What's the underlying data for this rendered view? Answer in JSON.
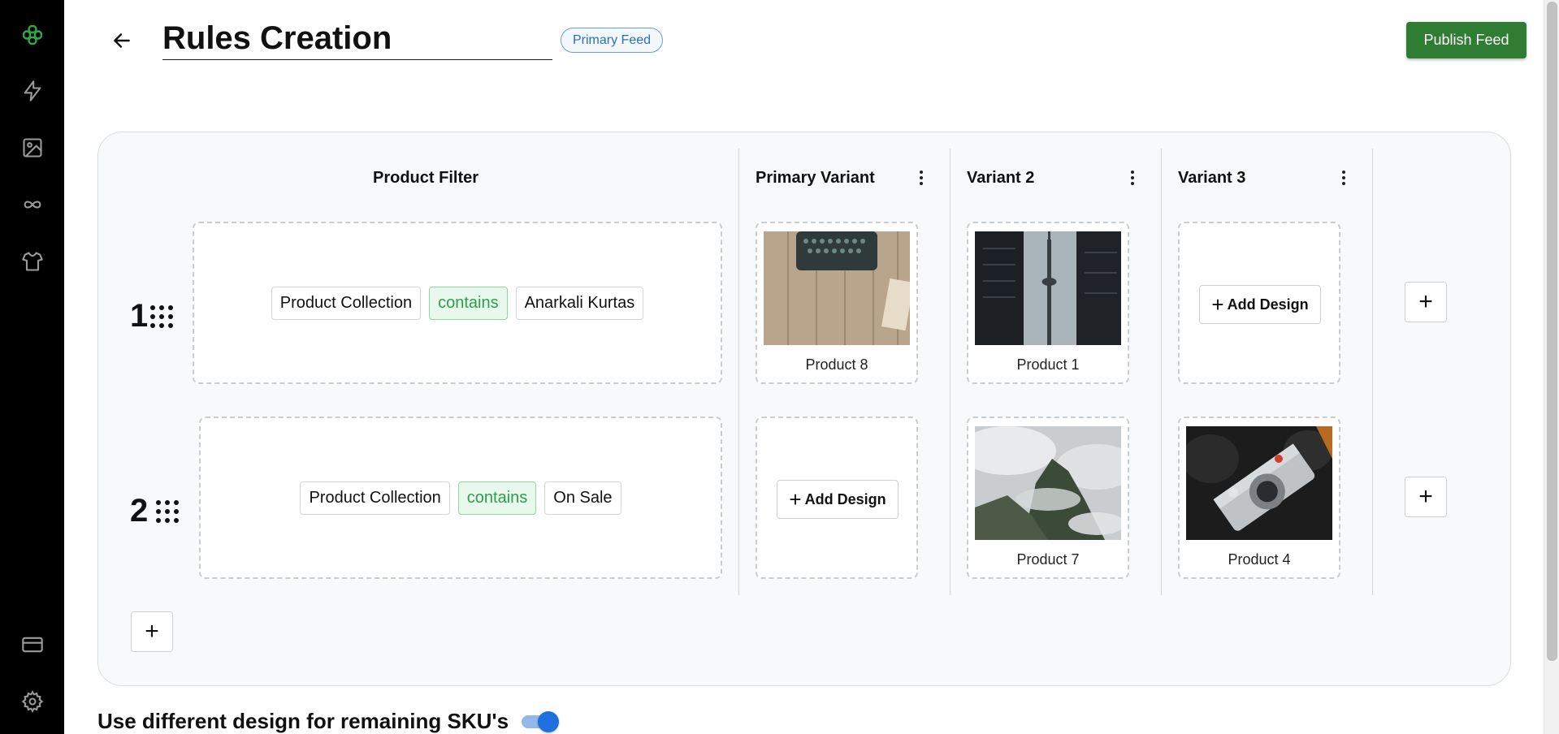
{
  "sidebar": {
    "items": [
      {
        "icon": "logo-icon"
      },
      {
        "icon": "lightning-icon"
      },
      {
        "icon": "image-icon"
      },
      {
        "icon": "infinity-icon"
      },
      {
        "icon": "shirt-icon"
      },
      {
        "icon": "credit-card-icon"
      },
      {
        "icon": "gear-icon"
      }
    ],
    "accent_color": "#2ea84f"
  },
  "header": {
    "title": "Rules Creation",
    "badge": "Primary Feed",
    "publish_label": "Publish Feed",
    "publish_color": "#2e7d32"
  },
  "columns": {
    "filter": "Product Filter",
    "variants": [
      "Primary Variant",
      "Variant 2",
      "Variant 3"
    ]
  },
  "rules": [
    {
      "number": "1",
      "filter": {
        "field": "Product Collection",
        "operator": "contains",
        "value": "Anarkali Kurtas"
      },
      "designs": [
        {
          "label": "Product 8",
          "image": "typewriter-image"
        },
        {
          "label": "Product 1",
          "image": "tower-image"
        },
        {
          "add_label": "Add Design"
        }
      ]
    },
    {
      "number": "2",
      "filter": {
        "field": "Product Collection",
        "operator": "contains",
        "value": "On Sale"
      },
      "designs": [
        {
          "add_label": "Add Design"
        },
        {
          "label": "Product 7",
          "image": "misty-forest-image"
        },
        {
          "label": "Product 4",
          "image": "camera-image"
        }
      ]
    }
  ],
  "footer": {
    "remaining_label": "Use different design for remaining SKU's",
    "remaining_enabled": true
  }
}
